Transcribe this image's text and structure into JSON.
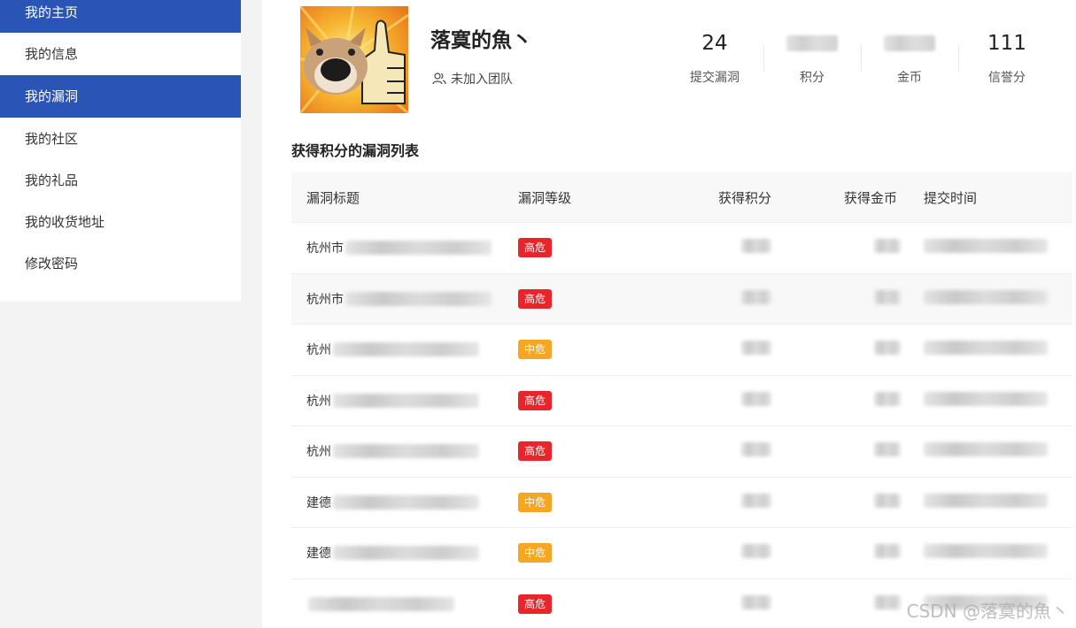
{
  "sidebar": {
    "items": [
      {
        "label": "我的主页",
        "active": true
      },
      {
        "label": "我的信息",
        "active": false
      },
      {
        "label": "我的漏洞",
        "active": true
      },
      {
        "label": "我的社区",
        "active": false
      },
      {
        "label": "我的礼品",
        "active": false
      },
      {
        "label": "我的收货地址",
        "active": false
      },
      {
        "label": "修改密码",
        "active": false
      }
    ]
  },
  "profile": {
    "username": "落寞的魚丶",
    "team": "未加入团队",
    "stats": [
      {
        "value": "24",
        "label": "提交漏洞"
      },
      {
        "value": "",
        "label": "积分"
      },
      {
        "value": "",
        "label": "金币"
      },
      {
        "value": "111",
        "label": "信誉分"
      }
    ]
  },
  "section_title": "获得积分的漏洞列表",
  "table": {
    "headers": [
      "漏洞标题",
      "漏洞等级",
      "获得积分",
      "获得金币",
      "提交时间"
    ],
    "rows": [
      {
        "title_prefix": "杭州市",
        "level": "高危"
      },
      {
        "title_prefix": "杭州市",
        "level": "高危"
      },
      {
        "title_prefix": "杭州",
        "level": "中危"
      },
      {
        "title_prefix": "杭州",
        "level": "高危"
      },
      {
        "title_prefix": "杭州",
        "level": "高危"
      },
      {
        "title_prefix": "建德",
        "level": "中危"
      },
      {
        "title_prefix": "建德",
        "level": "中危"
      },
      {
        "title_prefix": "",
        "level": "高危"
      }
    ]
  },
  "colors": {
    "sidebar_active": "#2a55b7",
    "badge_high": "#e8252b",
    "badge_mid": "#f5a623"
  },
  "watermark": "CSDN @落寞的魚丶"
}
